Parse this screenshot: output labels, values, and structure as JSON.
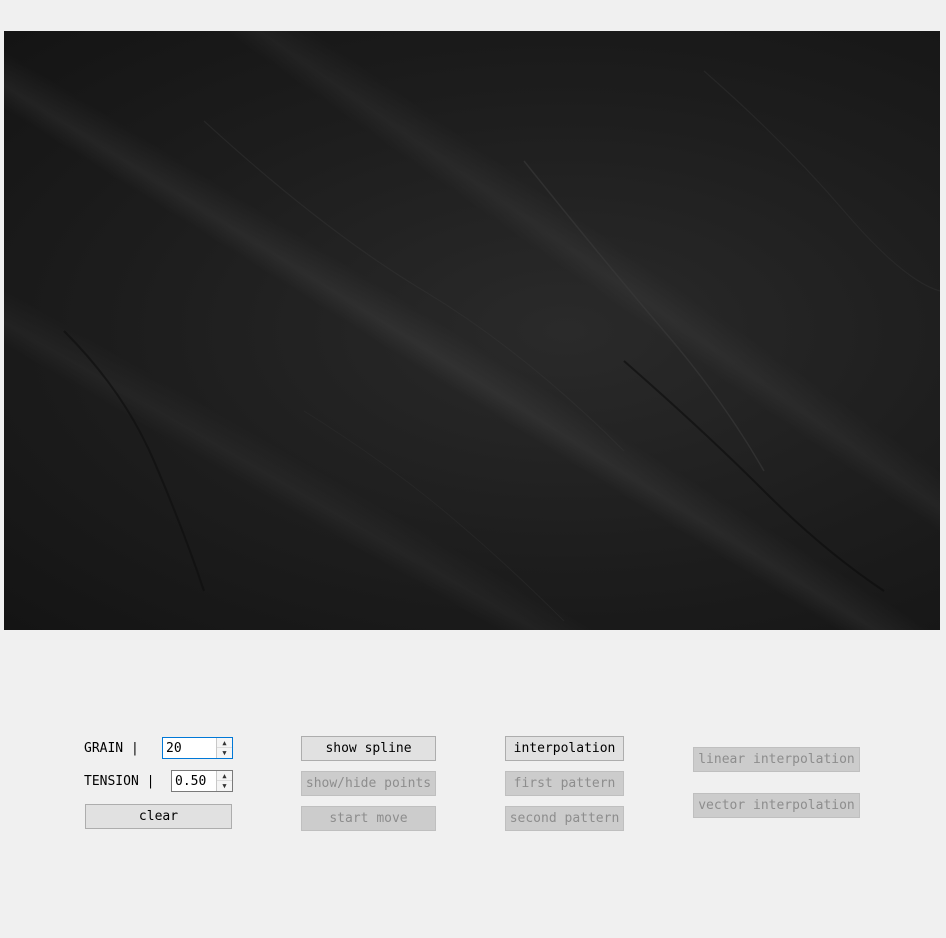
{
  "canvas": {
    "background_color": "#1e1e1e"
  },
  "controls": {
    "grain": {
      "label": "GRAIN |",
      "value": "20"
    },
    "tension": {
      "label": "TENSION |",
      "value": "0.50"
    },
    "clear_label": "clear"
  },
  "buttons": {
    "show_spline": "show spline",
    "show_hide_points": "show/hide points",
    "start_move": "start move",
    "interpolation": "interpolation",
    "first_pattern": "first pattern",
    "second_pattern": "second pattern",
    "linear_interpolation": "linear interpolation",
    "vector_interpolation": "vector interpolation"
  },
  "colors": {
    "window_bg": "#f0f0f0",
    "button_bg": "#e1e1e1",
    "disabled_bg": "#cccccc",
    "disabled_text": "#8d8d8d",
    "focus_border": "#0078d7"
  },
  "icons": {
    "spin_up": "spin-up-arrow-icon",
    "spin_down": "spin-down-arrow-icon"
  }
}
